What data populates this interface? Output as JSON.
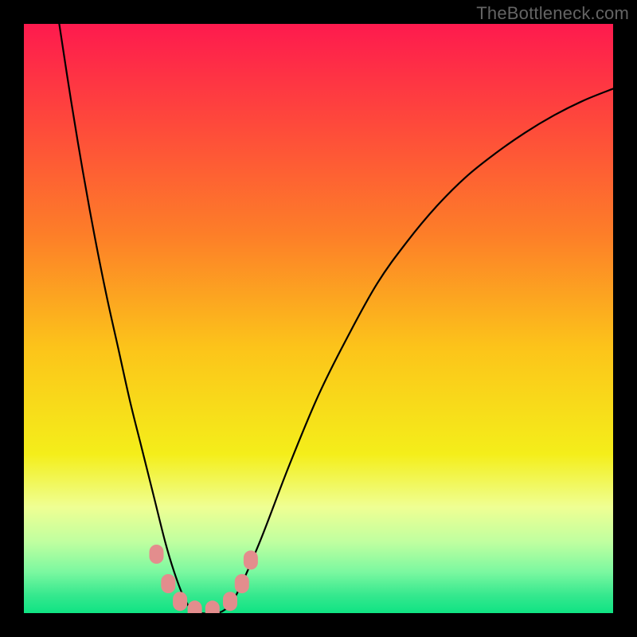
{
  "watermark": "TheBottleneck.com",
  "chart_data": {
    "type": "line",
    "title": "",
    "xlabel": "",
    "ylabel": "",
    "xlim": [
      0,
      100
    ],
    "ylim": [
      0,
      100
    ],
    "series": [
      {
        "name": "curve",
        "x": [
          6,
          8,
          10,
          12,
          14,
          16,
          18,
          20,
          22,
          24,
          25.5,
          27,
          28.5,
          30,
          32,
          34,
          36,
          40,
          45,
          50,
          55,
          60,
          65,
          70,
          75,
          80,
          85,
          90,
          95,
          100
        ],
        "values": [
          100,
          87,
          75,
          64,
          54,
          45,
          36,
          28,
          20,
          12,
          7,
          3,
          0.5,
          0,
          0,
          0.5,
          3,
          12,
          25,
          37,
          47,
          56,
          63,
          69,
          74,
          78,
          81.5,
          84.5,
          87,
          89
        ]
      }
    ],
    "markers": [
      {
        "x": 22.5,
        "y": 10
      },
      {
        "x": 24.5,
        "y": 5
      },
      {
        "x": 26.5,
        "y": 2
      },
      {
        "x": 29,
        "y": 0.5
      },
      {
        "x": 32,
        "y": 0.5
      },
      {
        "x": 35,
        "y": 2
      },
      {
        "x": 37,
        "y": 5
      },
      {
        "x": 38.5,
        "y": 9
      }
    ],
    "marker_color": "#e38d8d",
    "curve_color": "#000000",
    "gradient_stops": [
      {
        "offset": 0,
        "color": "#fe1a4e"
      },
      {
        "offset": 18,
        "color": "#fe4c3a"
      },
      {
        "offset": 36,
        "color": "#fd7f28"
      },
      {
        "offset": 55,
        "color": "#fcc41a"
      },
      {
        "offset": 73,
        "color": "#f4ee1a"
      },
      {
        "offset": 82,
        "color": "#efff93"
      },
      {
        "offset": 88,
        "color": "#bfffa0"
      },
      {
        "offset": 93,
        "color": "#7bf8a0"
      },
      {
        "offset": 97,
        "color": "#35e88e"
      },
      {
        "offset": 100,
        "color": "#0fe383"
      }
    ]
  }
}
